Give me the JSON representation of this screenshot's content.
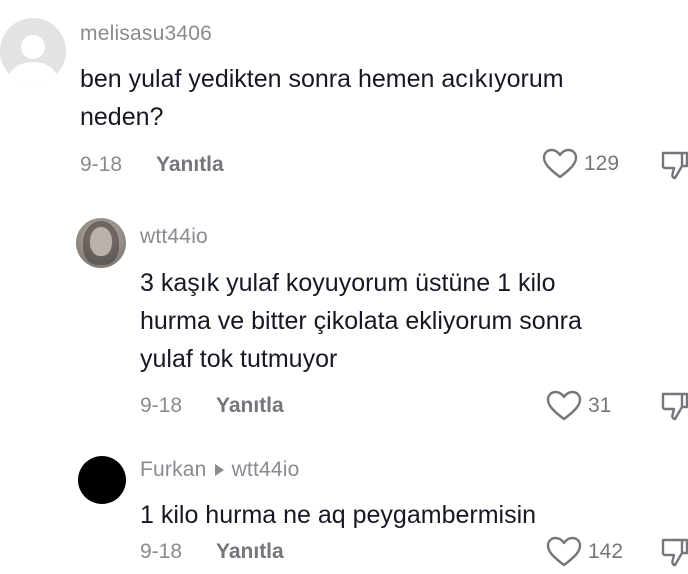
{
  "comments": [
    {
      "username": "melisasu3406",
      "text_line1": "ben yulaf yedikten sonra hemen acıkıyorum",
      "text_line2": "neden?",
      "date": "9-18",
      "reply_label": "Yanıtla",
      "likes": "129",
      "avatar_icon": "default-profile-icon"
    },
    {
      "username": "wtt44io",
      "text_line1": "3 kaşık yulaf koyuyorum üstüne 1 kilo",
      "text_line2": "hurma ve bitter çikolata ekliyorum sonra",
      "text_line3": "yulaf tok tutmuyor",
      "date": "9-18",
      "reply_label": "Yanıtla",
      "likes": "31",
      "avatar_icon": "profile-photo"
    },
    {
      "username": "Furkan",
      "reply_to": "wtt44io",
      "text_line1": "1 kilo hurma ne aq peygambermisin",
      "date": "9-18",
      "reply_label": "Yanıtla",
      "likes": "142",
      "avatar_icon": "black-avatar"
    }
  ],
  "colors": {
    "username": "#8a8b91",
    "text": "#161823",
    "meta": "#75767c",
    "background": "#ffffff"
  }
}
